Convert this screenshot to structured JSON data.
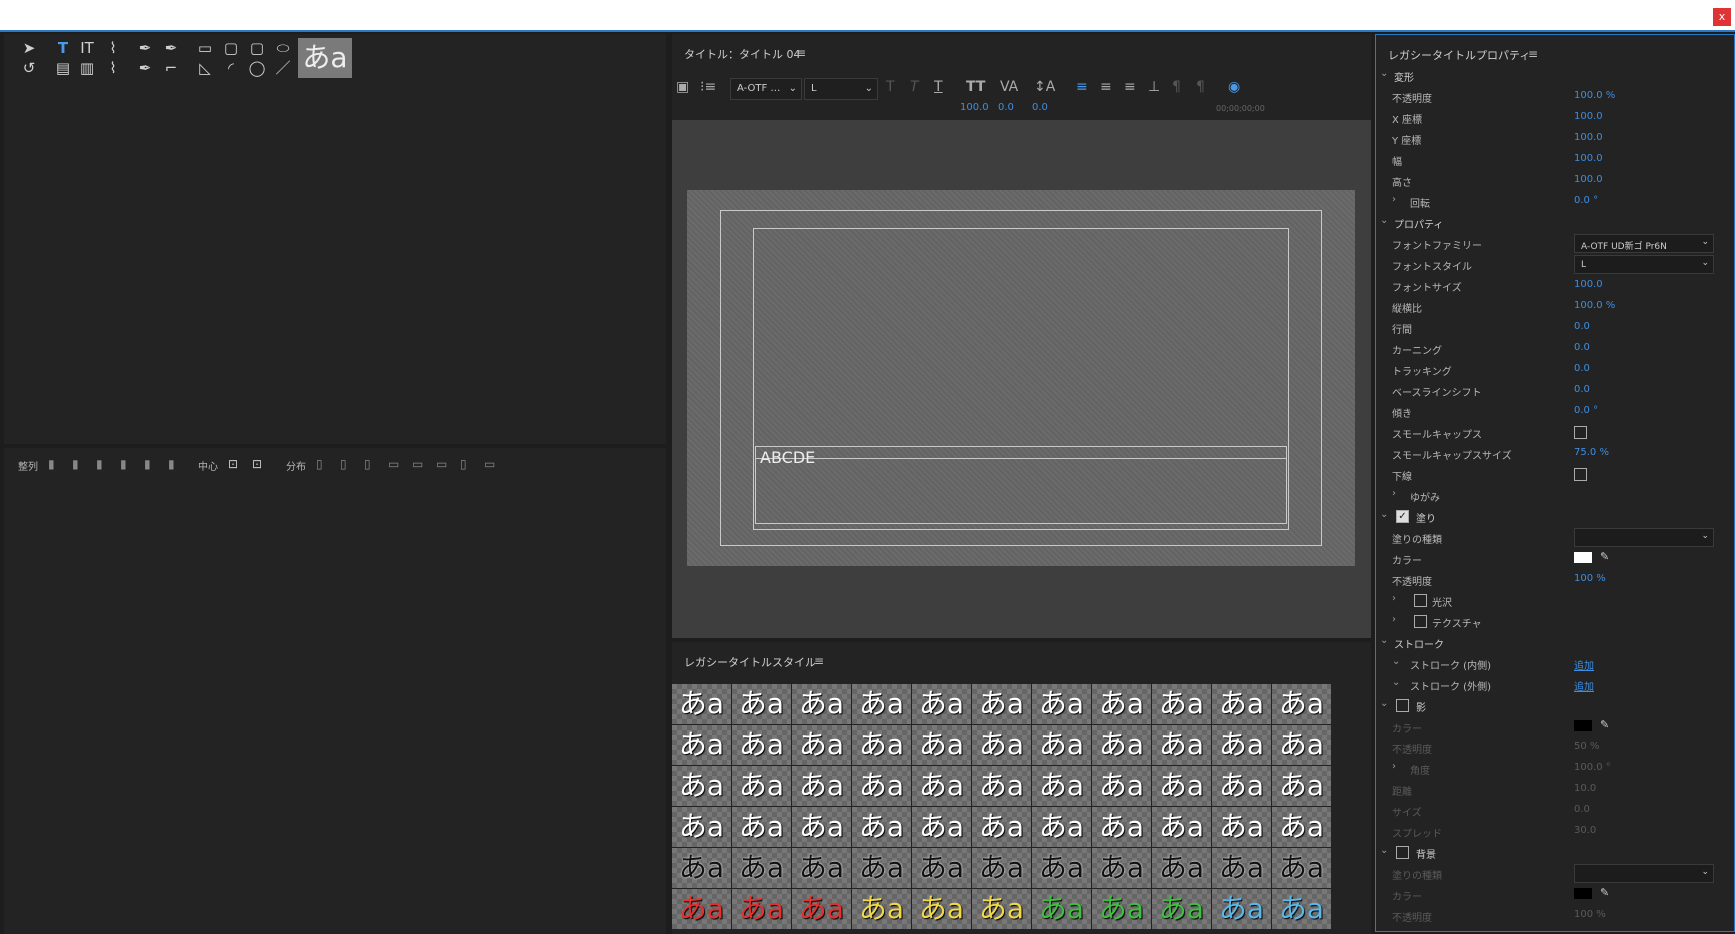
{
  "window": {
    "close_label": "x"
  },
  "tools": {
    "preview_text": "あa"
  },
  "align": {
    "align_label": "整列",
    "center_label": "中心",
    "distribute_label": "分布"
  },
  "editor": {
    "title": "タイトル：タイトル 04",
    "font_family": "A-OTF …",
    "font_style": "L",
    "values": [
      "100.0",
      "0.0",
      "0.0"
    ],
    "timecode": "00;00;00;00",
    "sample_text": "ABCDE"
  },
  "styles": {
    "title": "レガシータイトルスタイル",
    "cell_text": "あa",
    "rows": [
      [
        "#ffffff",
        "#ffffff",
        "#ffffff",
        "#ffffff",
        "#ffffff",
        "#ffffff",
        "#ffffff",
        "#ffffff",
        "#ffffff",
        "#ffffff",
        "#ffffff"
      ],
      [
        "#ffffff",
        "#ffffff",
        "#ffffff",
        "#ffffff",
        "#ffffff",
        "#ffffff",
        "#ffffff",
        "#ffffff",
        "#ffffff",
        "#ffffff",
        "#ffffff"
      ],
      [
        "#ffffff",
        "#ffffff",
        "#ffffff",
        "#ffffff",
        "#ffffff",
        "#ffffff",
        "#ffffff",
        "#ffffff",
        "#ffffff",
        "#ffffff",
        "#ffffff"
      ],
      [
        "#ffffff",
        "#ffffff",
        "#ffffff",
        "#ffffff",
        "#ffffff",
        "#ffffff",
        "#ffffff",
        "#ffffff",
        "#ffffff",
        "#ffffff",
        "#ffffff"
      ],
      [
        "#111111",
        "#111111",
        "#111111",
        "#111111",
        "#111111",
        "#111111",
        "#111111",
        "#111111",
        "#111111",
        "#111111",
        "#111111"
      ],
      [
        "#e53030",
        "#e53030",
        "#e53030",
        "#f0d848",
        "#f0d848",
        "#f0d848",
        "#3fbf3f",
        "#3fbf3f",
        "#3fbf3f",
        "#5ab8e8",
        "#5ab8e8"
      ]
    ]
  },
  "props": {
    "title": "レガシータイトルプロパティ",
    "rows": [
      {
        "type": "section",
        "label": "変形",
        "open": true
      },
      {
        "type": "value",
        "label": "不透明度",
        "value": "100.0 %"
      },
      {
        "type": "value",
        "label": "X 座標",
        "value": "100.0"
      },
      {
        "type": "value",
        "label": "Y 座標",
        "value": "100.0"
      },
      {
        "type": "value",
        "label": "幅",
        "value": "100.0"
      },
      {
        "type": "value",
        "label": "高さ",
        "value": "100.0"
      },
      {
        "type": "subsection",
        "label": "回転",
        "value": "0.0 °"
      },
      {
        "type": "section",
        "label": "プロパティ",
        "open": true
      },
      {
        "type": "select",
        "label": "フォントファミリー",
        "value": "A-OTF UD新ゴ Pr6N"
      },
      {
        "type": "select",
        "label": "フォントスタイル",
        "value": "L"
      },
      {
        "type": "value",
        "label": "フォントサイズ",
        "value": "100.0"
      },
      {
        "type": "value",
        "label": "縦横比",
        "value": "100.0 %"
      },
      {
        "type": "value",
        "label": "行間",
        "value": "0.0"
      },
      {
        "type": "value",
        "label": "カーニング",
        "value": "0.0"
      },
      {
        "type": "value",
        "label": "トラッキング",
        "value": "0.0"
      },
      {
        "type": "value",
        "label": "ベースラインシフト",
        "value": "0.0"
      },
      {
        "type": "value",
        "label": "傾き",
        "value": "0.0 °"
      },
      {
        "type": "check",
        "label": "スモールキャップス",
        "checked": false
      },
      {
        "type": "value",
        "label": "スモールキャップスサイズ",
        "value": "75.0 %"
      },
      {
        "type": "check",
        "label": "下線",
        "checked": false
      },
      {
        "type": "subsection",
        "label": "ゆがみ",
        "value": ""
      },
      {
        "type": "checksection",
        "label": "塗り",
        "checked": true
      },
      {
        "type": "select",
        "label": "塗りの種類",
        "value": ""
      },
      {
        "type": "color",
        "label": "カラー",
        "color": "#ffffff"
      },
      {
        "type": "value",
        "label": "不透明度",
        "value": "100 %"
      },
      {
        "type": "checksub",
        "label": "光沢",
        "checked": false
      },
      {
        "type": "checksub",
        "label": "テクスチャ",
        "checked": false
      },
      {
        "type": "section",
        "label": "ストローク",
        "open": true
      },
      {
        "type": "link",
        "label": "ストローク (内側)",
        "value": "追加"
      },
      {
        "type": "link",
        "label": "ストローク (外側)",
        "value": "追加"
      },
      {
        "type": "checksection",
        "label": "影",
        "checked": false
      },
      {
        "type": "color",
        "label": "カラー",
        "color": "#000000",
        "dim": true
      },
      {
        "type": "value",
        "label": "不透明度",
        "value": "50 %",
        "dim": true
      },
      {
        "type": "subsection",
        "label": "角度",
        "value": "100.0 °",
        "dim": true
      },
      {
        "type": "value",
        "label": "距離",
        "value": "10.0",
        "dim": true
      },
      {
        "type": "value",
        "label": "サイズ",
        "value": "0.0",
        "dim": true
      },
      {
        "type": "value",
        "label": "スプレッド",
        "value": "30.0",
        "dim": true
      },
      {
        "type": "checksection",
        "label": "背景",
        "checked": false
      },
      {
        "type": "select",
        "label": "塗りの種類",
        "value": "",
        "dim": true
      },
      {
        "type": "color",
        "label": "カラー",
        "color": "#000000",
        "dim": true
      },
      {
        "type": "value",
        "label": "不透明度",
        "value": "100 %",
        "dim": true
      }
    ]
  }
}
